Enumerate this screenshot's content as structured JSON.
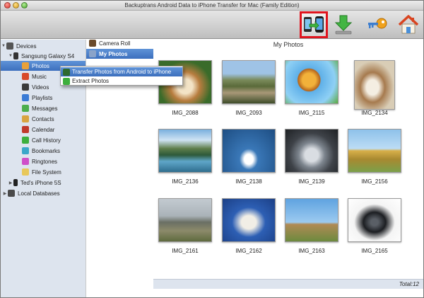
{
  "window": {
    "title": "Backuptrans Android Data to iPhone Transfer for Mac (Family Edition)"
  },
  "toolbar": {
    "buttons": [
      {
        "name": "transfer-to-iphone",
        "icon": "phone-transfer-icon",
        "highlighted": true,
        "highlight_color": "#e0141e"
      },
      {
        "name": "export",
        "icon": "download-arrow-icon"
      },
      {
        "name": "register",
        "icon": "key-icon"
      },
      {
        "name": "home",
        "icon": "home-icon"
      }
    ]
  },
  "tree": {
    "devices_label": "Devices",
    "device_label": "Sangsung Galaxy S4",
    "items": [
      {
        "label": "Photos",
        "icon": "photos-icon",
        "color": "#e8a13a",
        "selected": true
      },
      {
        "label": "Music",
        "icon": "music-icon",
        "color": "#d84a2a"
      },
      {
        "label": "Videos",
        "icon": "videos-icon",
        "color": "#3a3a3a"
      },
      {
        "label": "Playlists",
        "icon": "playlists-icon",
        "color": "#3a7bd5"
      },
      {
        "label": "Messages",
        "icon": "messages-icon",
        "color": "#4cae4c"
      },
      {
        "label": "Contacts",
        "icon": "contacts-icon",
        "color": "#d9a441"
      },
      {
        "label": "Calendar",
        "icon": "calendar-icon",
        "color": "#c0392b"
      },
      {
        "label": "Call History",
        "icon": "call-history-icon",
        "color": "#3daf3d"
      },
      {
        "label": "Bookmarks",
        "icon": "bookmarks-icon",
        "color": "#3aa7c9"
      },
      {
        "label": "Ringtones",
        "icon": "ringtones-icon",
        "color": "#cf4fc9"
      },
      {
        "label": "File System",
        "icon": "folder-icon",
        "color": "#e8c85a"
      }
    ],
    "iphone_label": "Ted's iPhone 5S",
    "local_db_label": "Local Databases"
  },
  "submenu": {
    "items": [
      {
        "label": "Camera Roll",
        "icon": "camera-roll-icon"
      },
      {
        "label": "My Photos",
        "icon": "my-photos-icon",
        "selected": true
      }
    ]
  },
  "context_menu": {
    "items": [
      {
        "label": "Transfer Photos from Android to iPhone",
        "icon": "phone-transfer-icon",
        "highlighted": true
      },
      {
        "label": "Extract Photos",
        "icon": "extract-icon"
      }
    ]
  },
  "main": {
    "title": "My Photos",
    "photos": [
      {
        "name": "IMG_2088",
        "subject": "dog"
      },
      {
        "name": "IMG_2093",
        "subject": "great-wall"
      },
      {
        "name": "IMG_2115",
        "subject": "lion-cartoon"
      },
      {
        "name": "IMG_2134",
        "subject": "puppy"
      },
      {
        "name": "IMG_2136",
        "subject": "lake-mountains"
      },
      {
        "name": "IMG_2138",
        "subject": "swan"
      },
      {
        "name": "IMG_2139",
        "subject": "car"
      },
      {
        "name": "IMG_2156",
        "subject": "pyramids"
      },
      {
        "name": "IMG_2161",
        "subject": "elephant"
      },
      {
        "name": "IMG_2162",
        "subject": "capitol"
      },
      {
        "name": "IMG_2163",
        "subject": "windmill"
      },
      {
        "name": "IMG_2165",
        "subject": "sports-car"
      }
    ]
  },
  "status": {
    "total": "Total:12"
  }
}
